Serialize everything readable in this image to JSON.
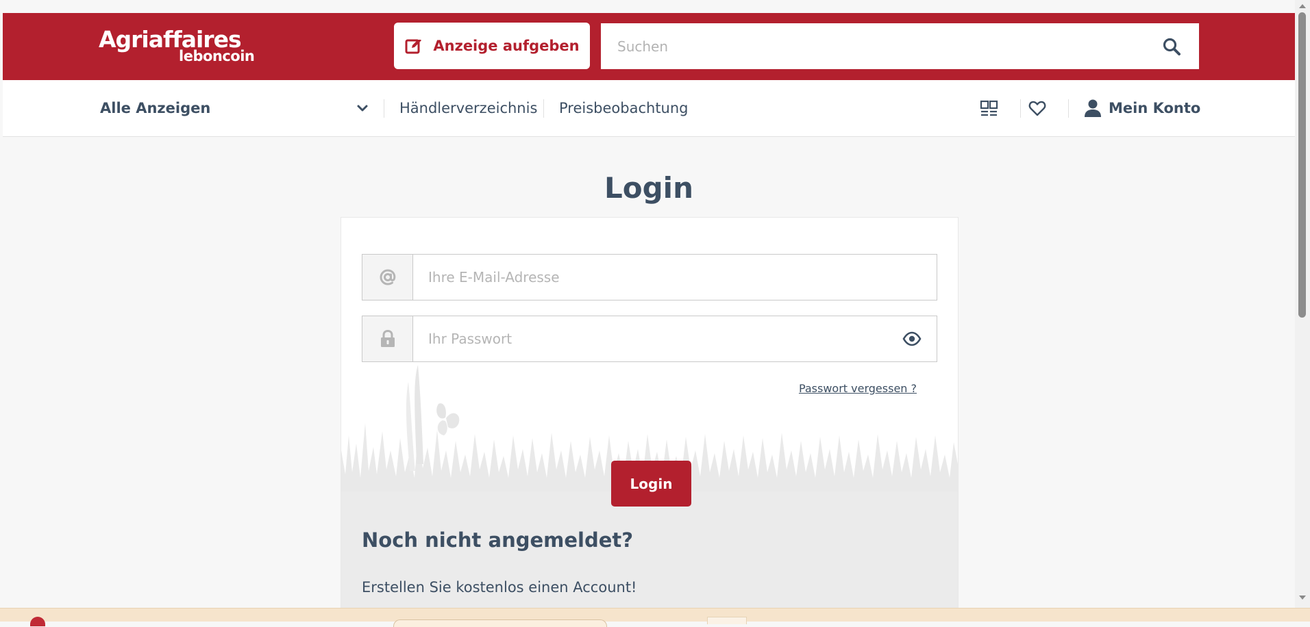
{
  "header": {
    "logo_line1": "Agriaffaires",
    "logo_line2": "leboncoin",
    "post_ad_label": "Anzeige aufgeben",
    "search_placeholder": "Suchen"
  },
  "nav": {
    "all_ads_label": "Alle Anzeigen",
    "dealer_directory_label": "Händlerverzeichnis",
    "price_watch_label": "Preisbeobachtung",
    "account_label": "Mein Konto"
  },
  "login": {
    "title": "Login",
    "email_placeholder": "Ihre E-Mail-Adresse",
    "password_placeholder": "Ihr Passwort",
    "forgot_password_label": "Passwort vergessen ?",
    "login_button_label": "Login",
    "not_registered_title": "Noch nicht angemeldet?",
    "create_account_text": "Erstellen Sie kostenlos einen Account!"
  },
  "colors": {
    "brand_red": "#b3202e",
    "text_dark": "#3d4f63",
    "page_bg": "#f7f7f7",
    "grass": "#e9e9e9"
  },
  "icons": {
    "post_ad": "edit-square-icon",
    "search": "search-icon",
    "dropdown": "chevron-down-icon",
    "compare": "compare-grid-icon",
    "favorites": "heart-icon",
    "account": "user-icon",
    "email": "at-sign-icon",
    "password": "lock-icon",
    "show_password": "eye-icon"
  }
}
